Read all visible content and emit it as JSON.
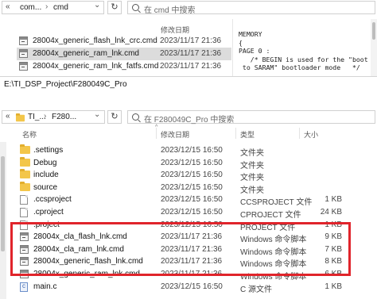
{
  "back_window": {
    "address": {
      "overflow_label": "«",
      "segments": [
        "com...",
        "cmd"
      ],
      "separator": "›",
      "dropdown_glyph": "⌄",
      "refresh_glyph": "↻"
    },
    "search_placeholder": "在 cmd 中搜索",
    "column_header": "修改日期",
    "files": [
      {
        "name": "28004x_generic_flash_lnk_crc.cmd",
        "date": "2023/11/17 21:36",
        "selected": false
      },
      {
        "name": "28004x_generic_ram_lnk.cmd",
        "date": "2023/11/17 21:36",
        "selected": true
      },
      {
        "name": "28004x_generic_ram_lnk_fatfs.cmd",
        "date": "2023/11/17 21:36",
        "selected": false
      }
    ],
    "code_preview": "MEMORY\n{\nPAGE 0 :\n   /* BEGIN is used for the \"boot\n to SARAM\" bootloader mode   */"
  },
  "front_window": {
    "title": "E:\\TI_DSP_Project\\F280049C_Pro",
    "address": {
      "overflow_label": "«",
      "segments": [
        "TI_...",
        "F280..."
      ],
      "separator": "›",
      "dropdown_glyph": "⌄",
      "refresh_glyph": "↻"
    },
    "search_placeholder": "在 F280049C_Pro 中搜索",
    "columns": {
      "name": "名称",
      "date": "修改日期",
      "type": "类型",
      "size": "大小",
      "sort_arrow": "^"
    },
    "files": [
      {
        "name": ".settings",
        "date": "2023/12/15 16:50",
        "type": "文件夹",
        "size": "",
        "icon": "folder-icon"
      },
      {
        "name": "Debug",
        "date": "2023/12/15 16:50",
        "type": "文件夹",
        "size": "",
        "icon": "folder-icon"
      },
      {
        "name": "include",
        "date": "2023/12/15 16:50",
        "type": "文件夹",
        "size": "",
        "icon": "folder-icon"
      },
      {
        "name": "source",
        "date": "2023/12/15 16:50",
        "type": "文件夹",
        "size": "",
        "icon": "folder-icon"
      },
      {
        "name": ".ccsproject",
        "date": "2023/12/15 16:50",
        "type": "CCSPROJECT 文件",
        "size": "1 KB",
        "icon": "doc-icon"
      },
      {
        "name": ".cproject",
        "date": "2023/12/15 16:50",
        "type": "CPROJECT 文件",
        "size": "24 KB",
        "icon": "doc-icon"
      },
      {
        "name": ".project",
        "date": "2023/12/15 16:50",
        "type": "PROJECT 文件",
        "size": "1 KB",
        "icon": "doc-icon"
      },
      {
        "name": "28004x_cla_flash_lnk.cmd",
        "date": "2023/11/17 21:36",
        "type": "Windows 命令脚本",
        "size": "9 KB",
        "icon": "cmd-icon"
      },
      {
        "name": "28004x_cla_ram_lnk.cmd",
        "date": "2023/11/17 21:36",
        "type": "Windows 命令脚本",
        "size": "7 KB",
        "icon": "cmd-icon"
      },
      {
        "name": "28004x_generic_flash_lnk.cmd",
        "date": "2023/11/17 21:36",
        "type": "Windows 命令脚本",
        "size": "8 KB",
        "icon": "cmd-icon"
      },
      {
        "name": "28004x_generic_ram_lnk.cmd",
        "date": "2023/11/17 21:36",
        "type": "Windows 命令脚本",
        "size": "6 KB",
        "icon": "cmd-icon"
      },
      {
        "name": "main.c",
        "date": "2023/12/15 16:50",
        "type": "C 源文件",
        "size": "1 KB",
        "icon": "c-icon"
      }
    ],
    "highlight_color": "#e0242b"
  }
}
